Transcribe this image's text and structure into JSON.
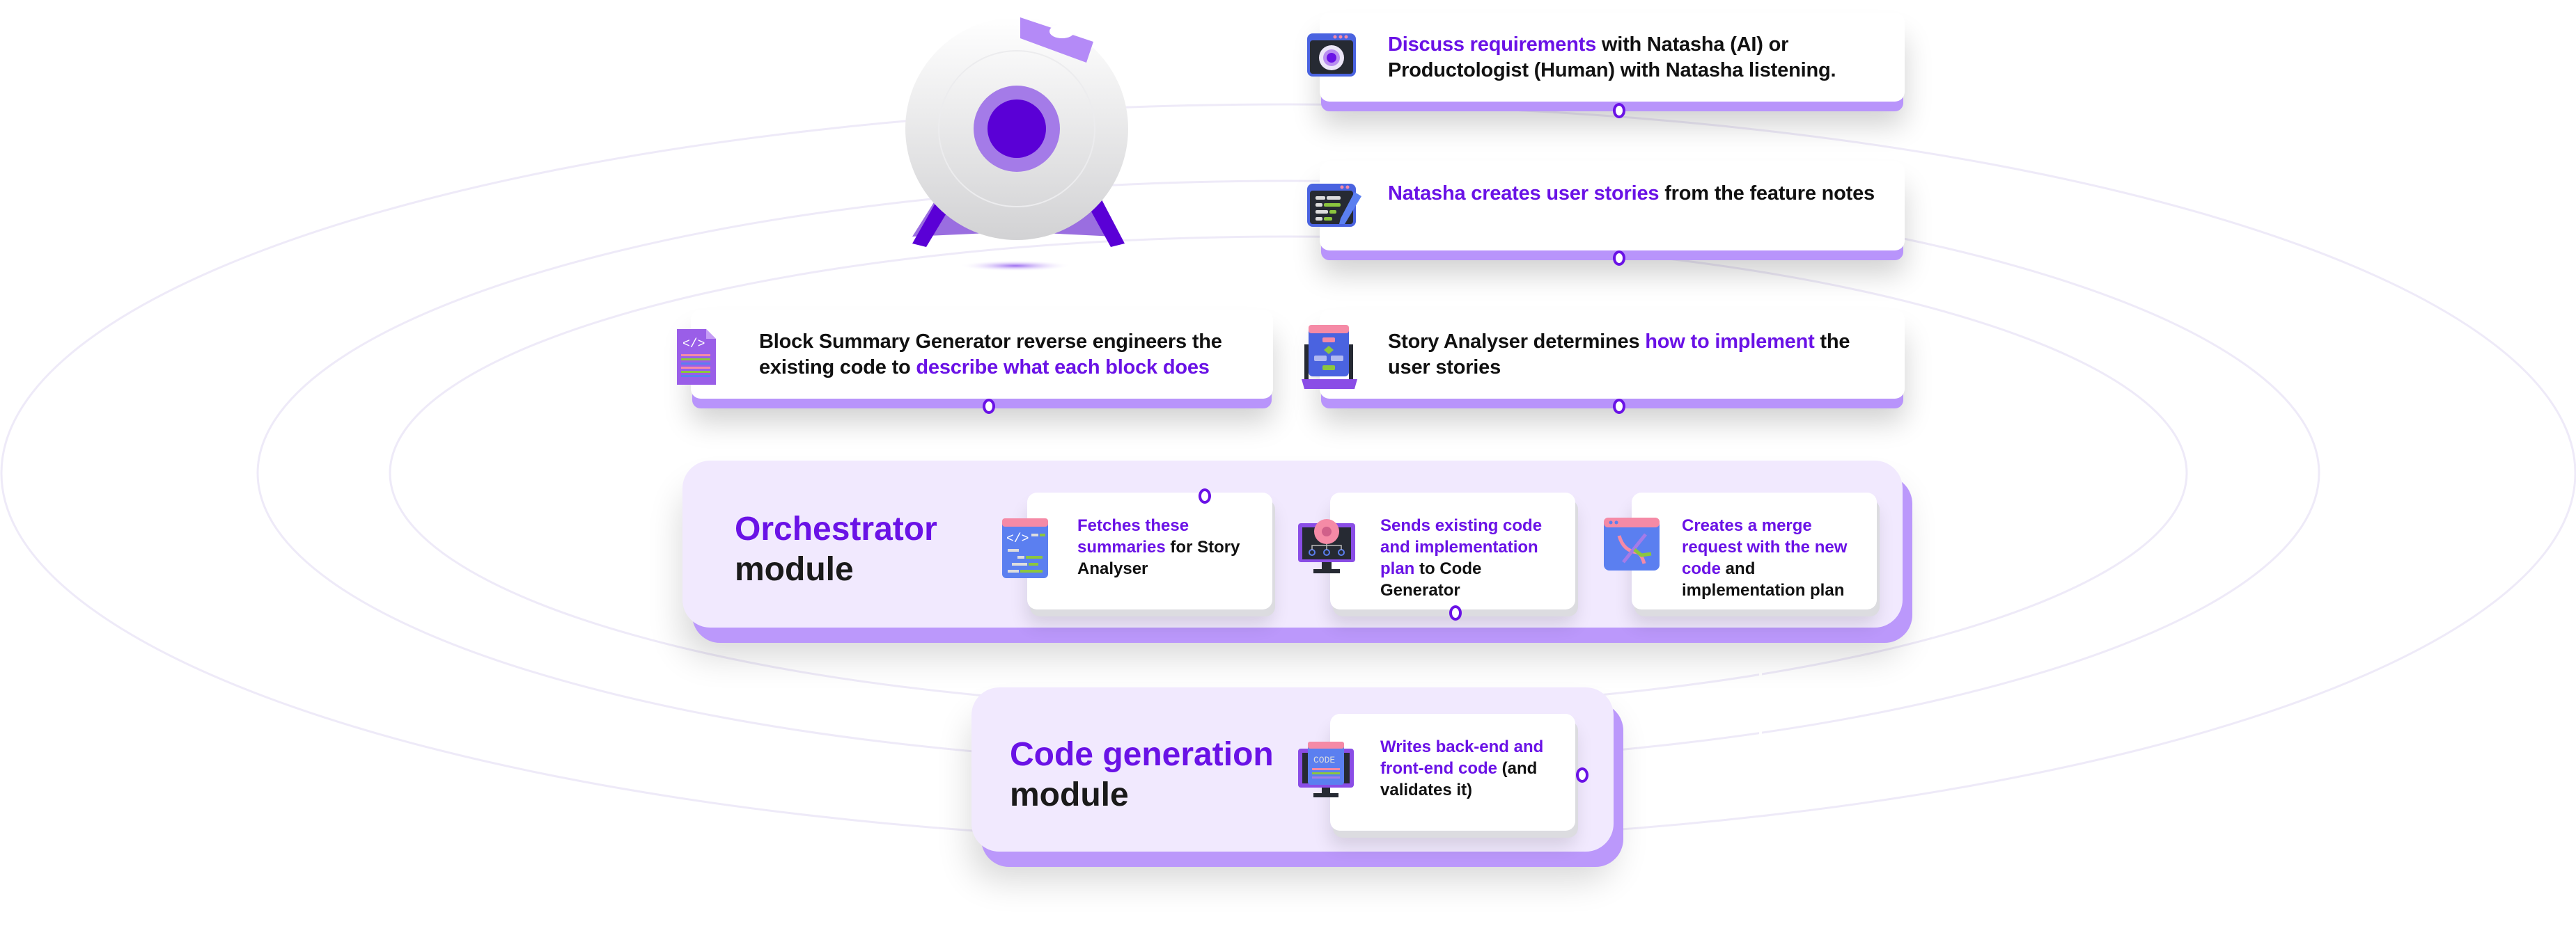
{
  "diagram": {
    "colors": {
      "accent": "#6a12e6",
      "accent_light": "#b894fb",
      "module_bg": "#f1e9fe",
      "text": "#111111"
    },
    "bot": {
      "name": "Natasha"
    },
    "steps": [
      {
        "id": "discuss",
        "icon": "webcam-window-icon",
        "highlight": "Discuss requirements",
        "rest": " with Natasha (AI) or Productologist (Human) with Natasha listening."
      },
      {
        "id": "user-stories",
        "icon": "notes-pen-icon",
        "highlight": "Natasha creates user stories",
        "rest": " from the feature notes"
      },
      {
        "id": "story-analyser",
        "icon": "flowchart-laptop-icon",
        "pre": "Story Analyser determines ",
        "highlight": "how to implement",
        "rest": " the user stories"
      },
      {
        "id": "block-summary",
        "icon": "code-file-icon",
        "pre": "Block Summary Generator reverse engineers the existing code to ",
        "highlight": "describe what each block does",
        "rest": ""
      }
    ],
    "orchestrator": {
      "title_line1": "Orchestrator",
      "title_line2": "module",
      "cards": [
        {
          "id": "fetch",
          "icon": "code-window-icon",
          "highlight": "Fetches these summaries",
          "rest": " for Story Analyser"
        },
        {
          "id": "send",
          "icon": "gear-monitor-icon",
          "highlight": "Sends existing code and implementation plan",
          "rest": " to Code Generator"
        },
        {
          "id": "merge",
          "icon": "merge-branch-icon",
          "highlight": "Creates a merge request with the new code",
          "rest": " and implementation plan"
        }
      ]
    },
    "code_generation": {
      "title_line1": "Code generation",
      "title_line2": "module",
      "cards": [
        {
          "id": "write",
          "icon": "code-monitor-icon",
          "highlight": "Writes back-end and front-end code",
          "rest": " (and validates it)"
        }
      ]
    }
  }
}
